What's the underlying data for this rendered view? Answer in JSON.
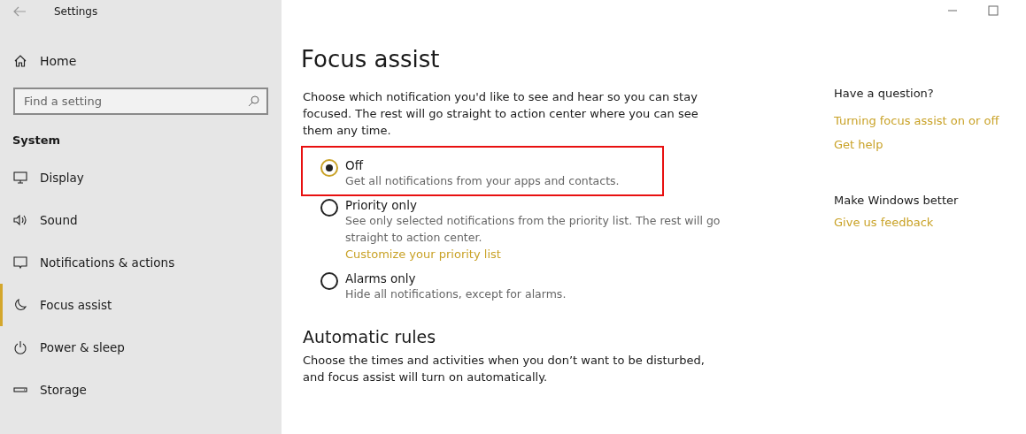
{
  "window": {
    "title": "Settings"
  },
  "sidebar": {
    "home": "Home",
    "search": {
      "placeholder": "Find a setting"
    },
    "section": "System",
    "items": [
      {
        "label": "Display",
        "kind": "display",
        "selected": false
      },
      {
        "label": "Sound",
        "kind": "sound",
        "selected": false
      },
      {
        "label": "Notifications & actions",
        "kind": "notifications",
        "selected": false
      },
      {
        "label": "Focus assist",
        "kind": "focus",
        "selected": true
      },
      {
        "label": "Power & sleep",
        "kind": "power",
        "selected": false
      },
      {
        "label": "Storage",
        "kind": "storage",
        "selected": false
      }
    ]
  },
  "page": {
    "title": "Focus assist",
    "description": "Choose which notification you'd like to see and hear so you can stay focused. The rest will go straight to action center where you can see them any time.",
    "options": [
      {
        "label": "Off",
        "description": "Get all notifications from your apps and contacts.",
        "selected": true,
        "highlighted": true
      },
      {
        "label": "Priority only",
        "description": "See only selected notifications from the priority list. The rest will go straight to action center.",
        "link": "Customize your priority list",
        "selected": false,
        "highlighted": false
      },
      {
        "label": "Alarms only",
        "description": "Hide all notifications, except for alarms.",
        "selected": false,
        "highlighted": false
      }
    ],
    "rules_title": "Automatic rules",
    "rules_description": "Choose the times and activities when you don’t want to be disturbed, and focus assist will turn on automatically."
  },
  "aside": {
    "question_title": "Have a question?",
    "question_links": [
      "Turning focus assist on or off",
      "Get help"
    ],
    "feedback_title": "Make Windows better",
    "feedback_link": "Give us feedback"
  }
}
